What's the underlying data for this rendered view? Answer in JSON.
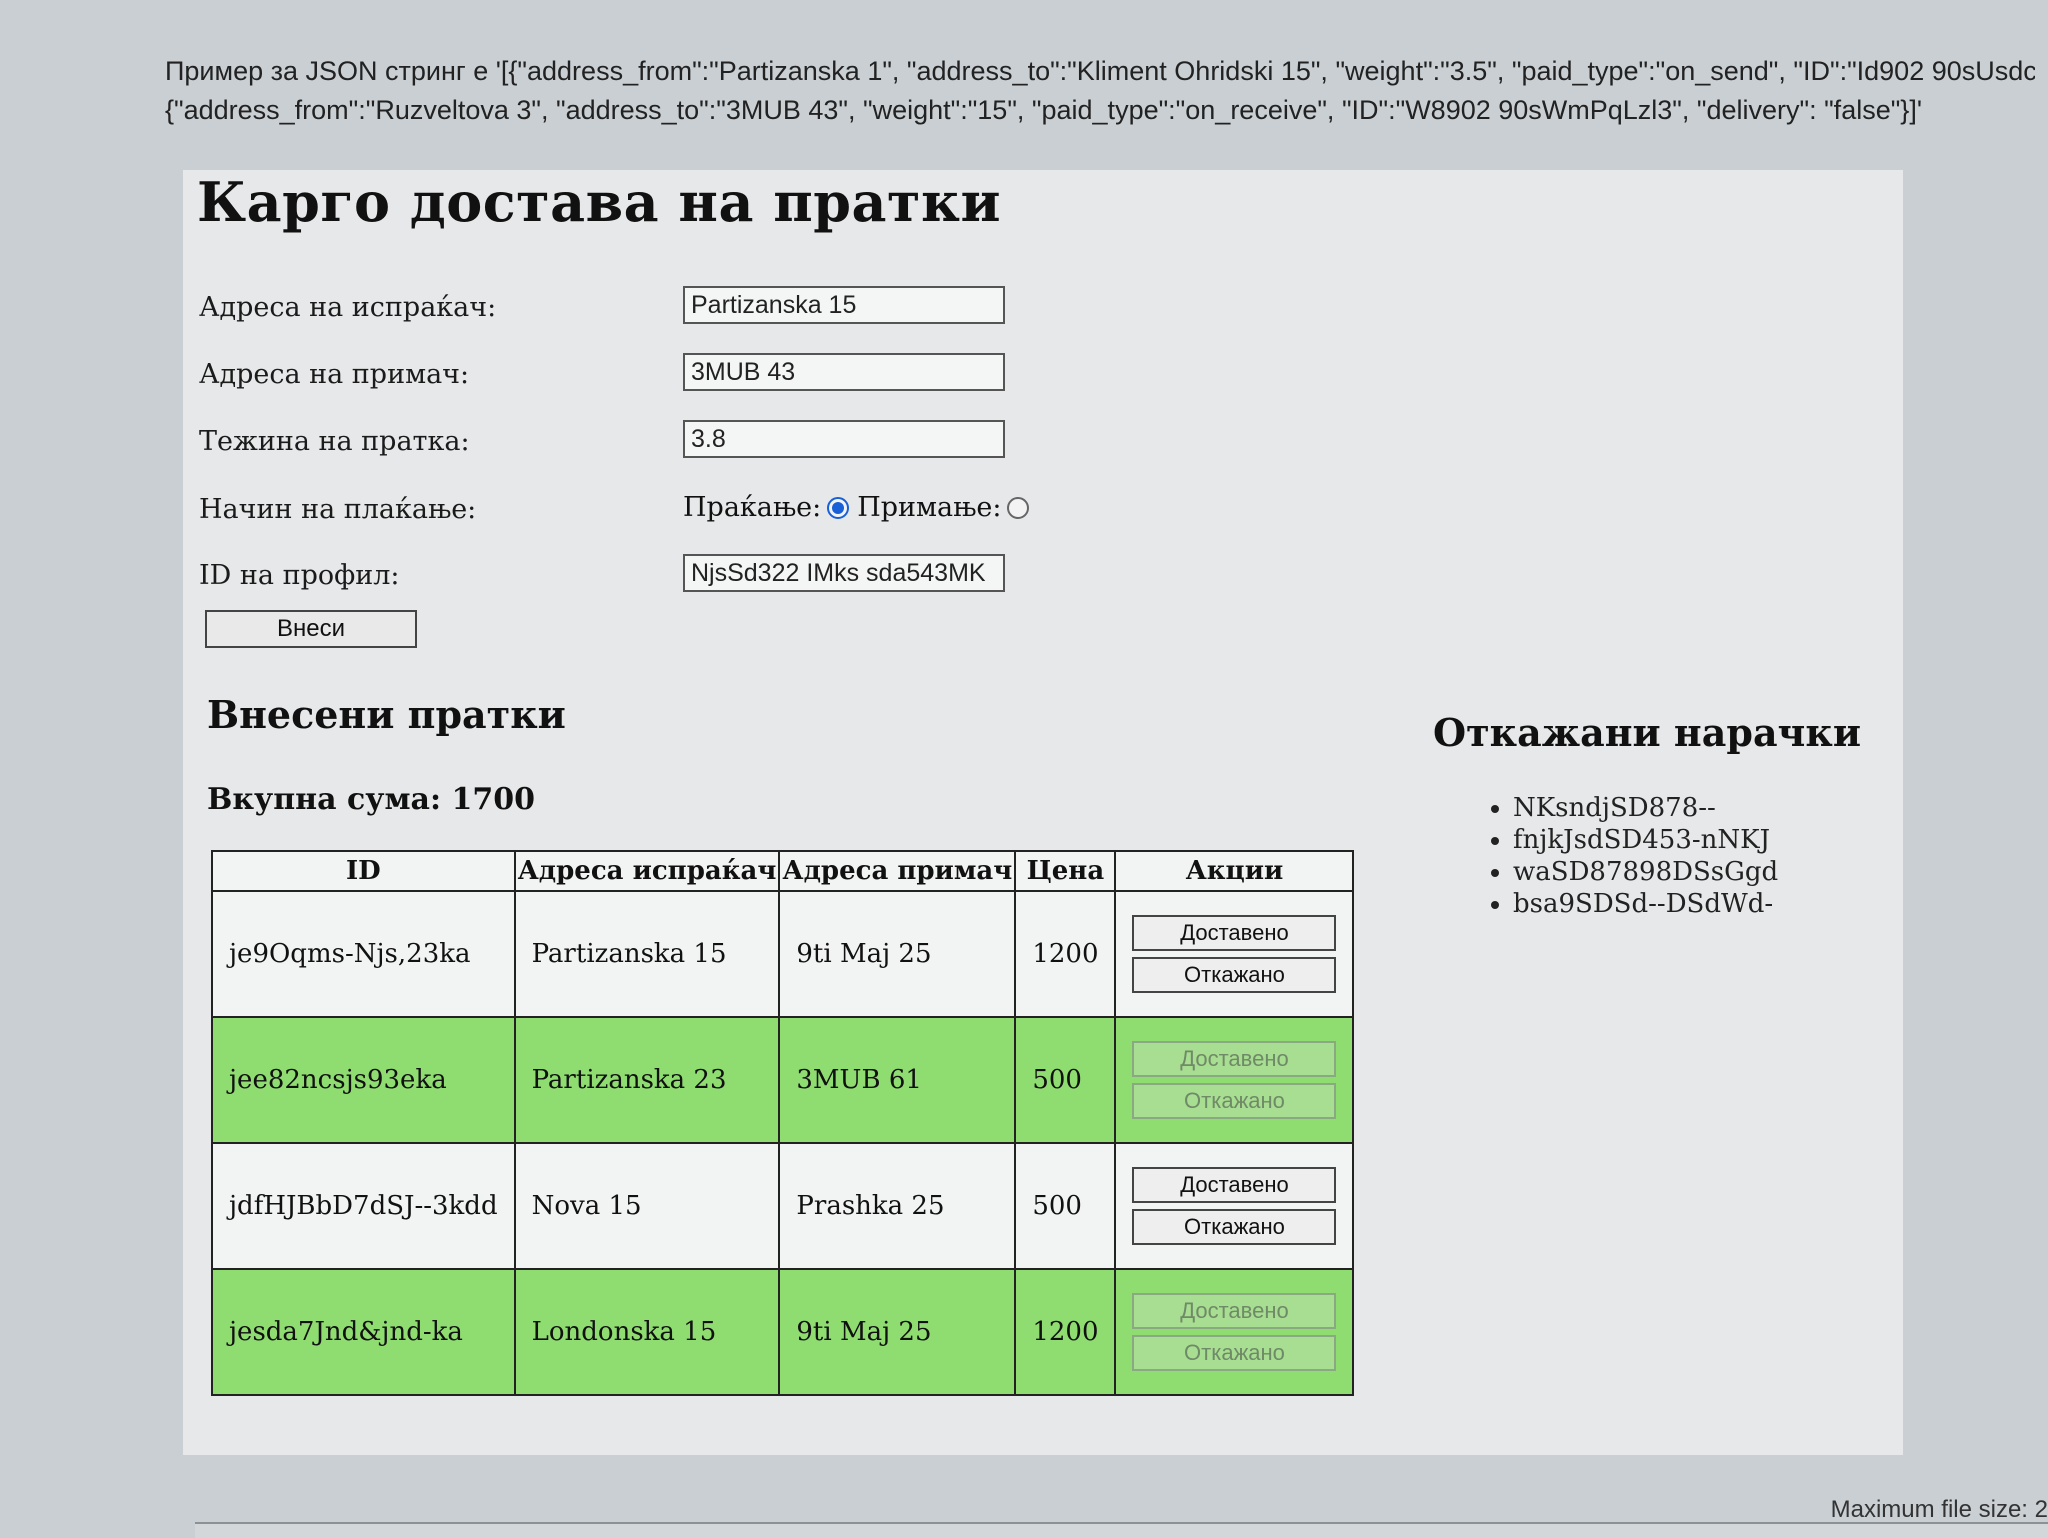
{
  "json_note": {
    "line1": "Пример за JSON стринг е '[{\"address_from\":\"Partizanska 1\", \"address_to\":\"Kliment Ohridski 15\", \"weight\":\"3.5\", \"paid_type\":\"on_send\", \"ID\":\"Id902 90sUsdc",
    "line2": "{\"address_from\":\"Ruzveltova 3\", \"address_to\":\"3MUB 43\", \"weight\":\"15\", \"paid_type\":\"on_receive\", \"ID\":\"W8902 90sWmPqLzl3\", \"delivery\": \"false\"}]'"
  },
  "page": {
    "title": "Карго достава на пратки"
  },
  "form": {
    "sender_label": "Адреса на испраќач:",
    "sender_value": "Partizanska 15",
    "receiver_label": "Адреса на примач:",
    "receiver_value": "3MUB 43",
    "weight_label": "Тежина на пратка:",
    "weight_value": "3.8",
    "payment_label": "Начин на плаќање:",
    "payment_option_send": "Праќање:",
    "payment_option_receive": "Примање:",
    "payment_selected": "Праќање",
    "profile_label": "ID на профил:",
    "profile_value": "NjsSd322 IMks sda543MK",
    "submit_label": "Внеси"
  },
  "orders": {
    "title": "Внесени пратки",
    "total_text": "Вкупна сума: 1700",
    "columns": [
      "ID",
      "Адреса испраќач",
      "Адреса примач",
      "Цена",
      "Акции"
    ],
    "delivered_label": "Доставено",
    "cancelled_label": "Откажано",
    "rows": [
      {
        "id": "je9Oqms-Njs,23ka",
        "from": "Partizanska 15",
        "to": "9ti Maj 25",
        "price": "1200",
        "delivered": false
      },
      {
        "id": "jee82ncsjs93eka",
        "from": "Partizanska 23",
        "to": "3MUB 61",
        "price": "500",
        "delivered": true
      },
      {
        "id": "jdfHJBbD7dSJ--3kdd",
        "from": "Nova 15",
        "to": "Prashka 25",
        "price": "500",
        "delivered": false
      },
      {
        "id": "jesda7Jnd&jnd-ka",
        "from": "Londonska 15",
        "to": "9ti Maj 25",
        "price": "1200",
        "delivered": true
      }
    ]
  },
  "cancelled": {
    "title": "Откажани нарачки",
    "items": [
      "NKsndjSD878--",
      "fnjkJsdSD453-nNKJ",
      "waSD87898DSsGgd",
      "bsa9SDSd--DSdWd-"
    ]
  },
  "footer": {
    "note": "Maximum file size: 2"
  },
  "colors": {
    "delivered_row": "#8fdc70",
    "radio_selected": "#1860d8",
    "panel_background": "#e6e8e9",
    "page_background": "#c9cfd3"
  }
}
